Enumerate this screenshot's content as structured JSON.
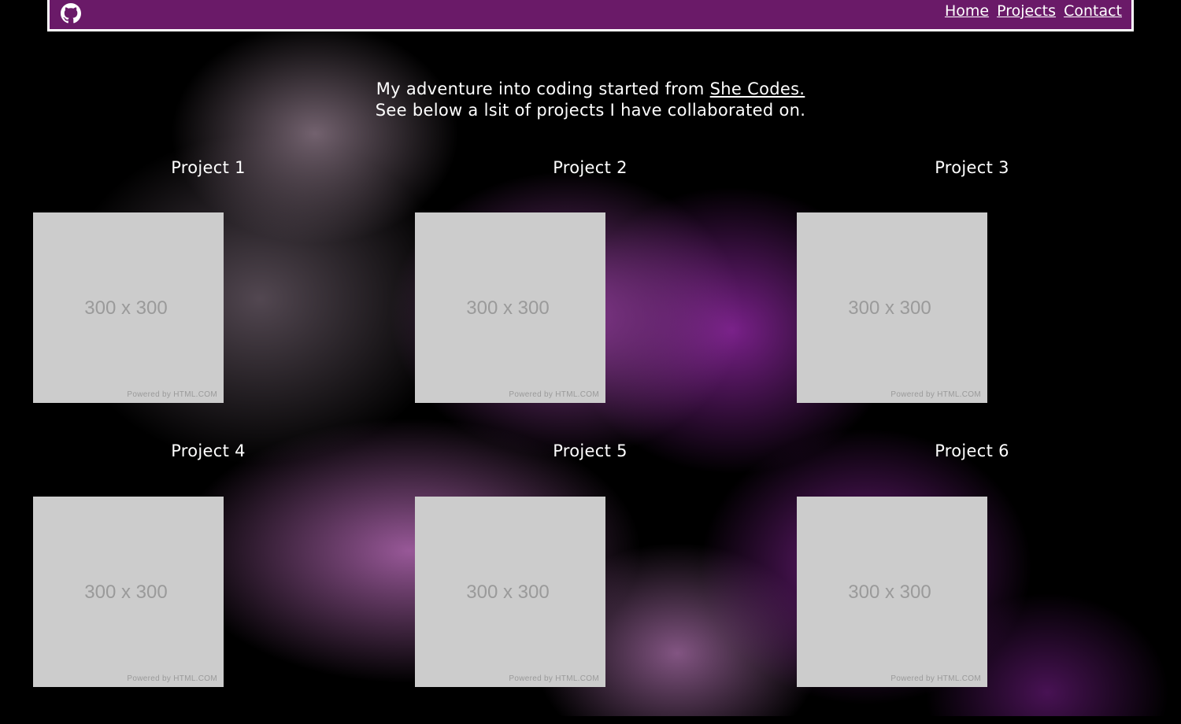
{
  "nav": {
    "github_icon": "github-icon",
    "links": [
      "Home",
      "Projects",
      "Contact"
    ]
  },
  "intro": {
    "line1_prefix": "My adventure into coding started from",
    "line1_link": "She Codes.",
    "line2": "See below a lsit of projects I have collaborated on."
  },
  "projects": [
    {
      "title": "Project 1",
      "image_label": "300 x 300",
      "powered_by": "Powered by HTML.COM"
    },
    {
      "title": "Project 2",
      "image_label": "300 x 300",
      "powered_by": "Powered by HTML.COM"
    },
    {
      "title": "Project 3",
      "image_label": "300 x 300",
      "powered_by": "Powered by HTML.COM"
    },
    {
      "title": "Project 4",
      "image_label": "300 x 300",
      "powered_by": "Powered by HTML.COM"
    },
    {
      "title": "Project 5",
      "image_label": "300 x 300",
      "powered_by": "Powered by HTML.COM"
    },
    {
      "title": "Project 6",
      "image_label": "300 x 300",
      "powered_by": "Powered by HTML.COM"
    }
  ],
  "colors": {
    "navbar": "#6a1a68",
    "placeholder": "#cccccc",
    "background": "#000000"
  }
}
